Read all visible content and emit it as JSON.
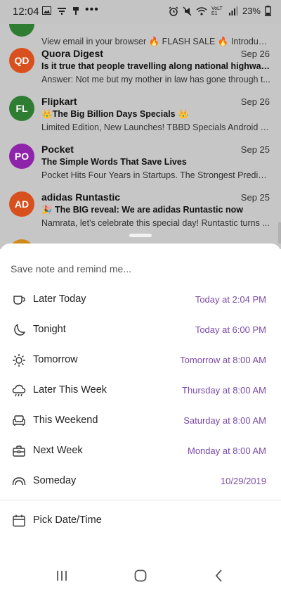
{
  "status_bar": {
    "time": "12:04",
    "battery": "23%",
    "network": "VoLTE1"
  },
  "emails": [
    {
      "subject_partial": "",
      "preview": "View email in your browser 🔥 FLASH SALE 🔥 Introducing..."
    },
    {
      "initials": "QD",
      "color": "#d9501f",
      "sender": "Quora Digest",
      "date": "Sep 26",
      "subject": "Is it true that people travelling along national highways e...",
      "preview": "Answer: Not me but my mother in law has gone through t..."
    },
    {
      "initials": "FL",
      "color": "#2e7d32",
      "sender": "Flipkart",
      "date": "Sep 26",
      "subject": "👑The Big Billion Days Specials 👑",
      "preview": "Limited Edition, New Launches! TBBD Specials Android T..."
    },
    {
      "initials": "PO",
      "color": "#8e24aa",
      "sender": "Pocket",
      "date": "Sep 25",
      "subject": "The Simple Words That Save Lives",
      "preview": "Pocket Hits Four Years in Startups. The Strongest Predict..."
    },
    {
      "initials": "AD",
      "color": "#d9501f",
      "sender": "adidas Runtastic",
      "date": "Sep 25",
      "subject": "🎉 The BIG reveal: We are adidas Runtastic now",
      "preview": "Namrata, let's celebrate this special day! Runtastic turns ..."
    }
  ],
  "sheet": {
    "title": "Save note and remind me...",
    "options": [
      {
        "label": "Later Today",
        "time": "Today at 2:04 PM",
        "icon": "cup-icon"
      },
      {
        "label": "Tonight",
        "time": "Today at 6:00 PM",
        "icon": "moon-icon"
      },
      {
        "label": "Tomorrow",
        "time": "Tomorrow at 8:00 AM",
        "icon": "sun-icon"
      },
      {
        "label": "Later This Week",
        "time": "Thursday at 8:00 AM",
        "icon": "cloud-rain-icon"
      },
      {
        "label": "This Weekend",
        "time": "Saturday at 8:00 AM",
        "icon": "armchair-icon"
      },
      {
        "label": "Next Week",
        "time": "Monday at 8:00 AM",
        "icon": "briefcase-icon"
      },
      {
        "label": "Someday",
        "time": "10/29/2019",
        "icon": "rainbow-icon"
      }
    ],
    "pick": {
      "label": "Pick Date/Time",
      "icon": "calendar-icon"
    }
  },
  "colors": {
    "accent": "#7b4aa6",
    "scrim": "#c6c6c6"
  }
}
